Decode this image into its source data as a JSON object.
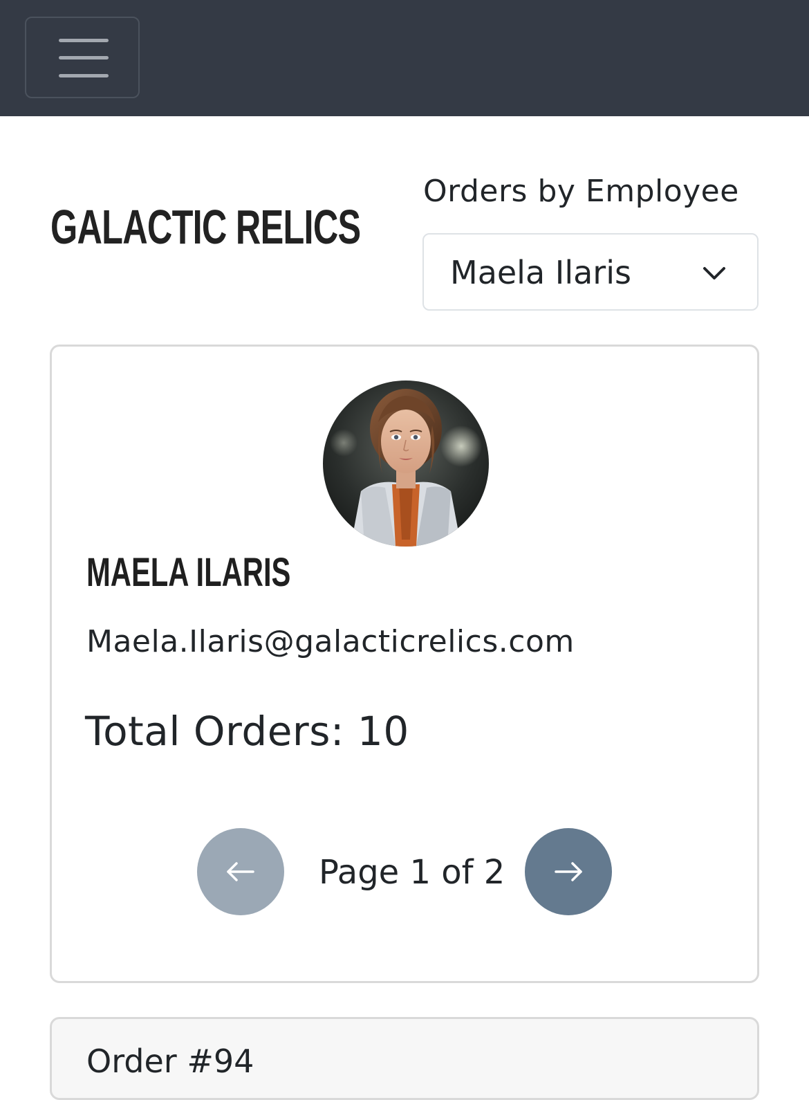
{
  "navbar": {
    "menu_icon": "hamburger-menu-icon",
    "background": "#343a45"
  },
  "header": {
    "brand": "GALACTIC RELICS",
    "employee_filter": {
      "label": "Orders by Employee",
      "selected": "Maela Ilaris",
      "icon": "chevron-down-icon"
    }
  },
  "employee": {
    "name": "MAELA ILARIS",
    "email": "Maela.Ilaris@galacticrelics.com",
    "total_orders_text": "Total Orders: 10",
    "avatar": "employee-portrait"
  },
  "pagination": {
    "text": "Page 1 of 2",
    "prev_icon": "arrow-left-icon",
    "next_icon": "arrow-right-icon",
    "prev_color": "#9ba8b5",
    "next_color": "#647a8f"
  },
  "orders": [
    {
      "title": "Order #94"
    }
  ]
}
